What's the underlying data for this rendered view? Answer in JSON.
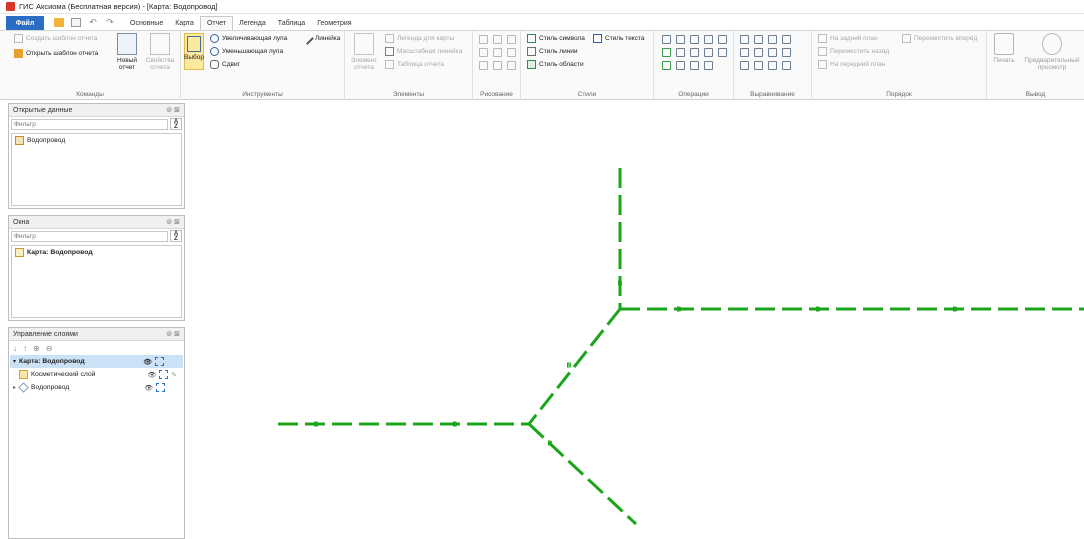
{
  "window": {
    "title": "ГИС Аксиома (Бесплатная версия) - [Карта: Водопровод]"
  },
  "tabs": {
    "file": "Файл",
    "items": [
      "Основные",
      "Карта",
      "Отчет",
      "Легенда",
      "Таблица",
      "Геометрия"
    ],
    "active_index": 2
  },
  "ribbon": {
    "commands": {
      "label": "Команды",
      "create_template": "Создать шаблон отчета",
      "open_template": "Открыть шаблон отчета",
      "new_report": "Новый отчет",
      "report_props": "Свойства отчета"
    },
    "tools": {
      "label": "Инструменты",
      "select": "Выбор",
      "zoom_in": "Увеличивающая лупа",
      "zoom_out": "Уменьшающая лупа",
      "pan": "Сдвиг",
      "ruler": "Линейка"
    },
    "elements": {
      "label": "Элементы",
      "report_element": "Элемент отчета",
      "map_legend": "Легенда для карты",
      "scale_bar": "Масштабная линейка",
      "report_table": "Таблица отчета"
    },
    "drawing": {
      "label": "Рисование"
    },
    "styles": {
      "label": "Стили",
      "symbol_style": "Стиль символа",
      "text_style": "Стиль текста",
      "line_style": "Стиль линии",
      "area_style": "Стиль области"
    },
    "operations": {
      "label": "Операции"
    },
    "alignment": {
      "label": "Выравнивание"
    },
    "order": {
      "label": "Порядок",
      "send_back": "На задний план",
      "bring_forward": "Переместить вперёд",
      "move_back": "Переместить назад",
      "bring_front": "На передний план"
    },
    "output": {
      "label": "Вывод",
      "print": "Печать",
      "preview": "Предварительный просмотр"
    }
  },
  "panels": {
    "open_data": {
      "title": "Открытые данные",
      "filter_placeholder": "Фильтр",
      "items": [
        "Водопровод"
      ]
    },
    "windows": {
      "title": "Окна",
      "filter_placeholder": "Фильтр",
      "items": [
        "Карта: Водопровод"
      ]
    },
    "layers": {
      "title": "Управление слоями",
      "root": "Карта: Водопровод",
      "items": [
        "Косметический слой",
        "Водопровод"
      ]
    }
  },
  "map": {
    "line_color": "#1aa51a",
    "labels": [
      "В",
      "В",
      "В",
      "В",
      "В",
      "В",
      "В",
      "В"
    ]
  },
  "colors": {
    "accent": "#2b6cc4",
    "selected": "#fce9a0",
    "pipe": "#1aa51a"
  }
}
